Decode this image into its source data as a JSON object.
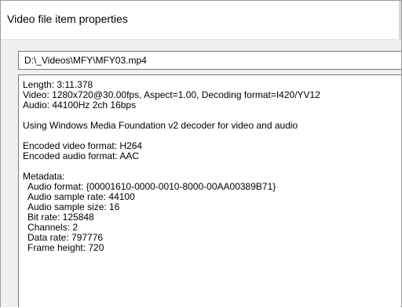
{
  "window": {
    "title": "Video file item properties"
  },
  "file": {
    "path": "D:\\_Videos\\MFY\\MFY03.mp4"
  },
  "info": {
    "length": "Length: 3:11.378",
    "video": "Video: 1280x720@30.00fps, Aspect=1.00, Decoding format=I420/YV12",
    "audio": "Audio: 44100Hz 2ch 16bps",
    "decoder": "Using Windows Media Foundation v2 decoder for video and audio",
    "encoded_video": "Encoded video format: H264",
    "encoded_audio": "Encoded audio format: AAC",
    "metadata_header": "Metadata:",
    "metadata": [
      "Audio format: {00001610-0000-0010-8000-00AA00389B71}",
      "Audio sample rate: 44100",
      "Audio sample size: 16",
      "Bit rate: 125848",
      "Channels: 2",
      "Data rate: 797776",
      "Frame height: 720"
    ]
  }
}
